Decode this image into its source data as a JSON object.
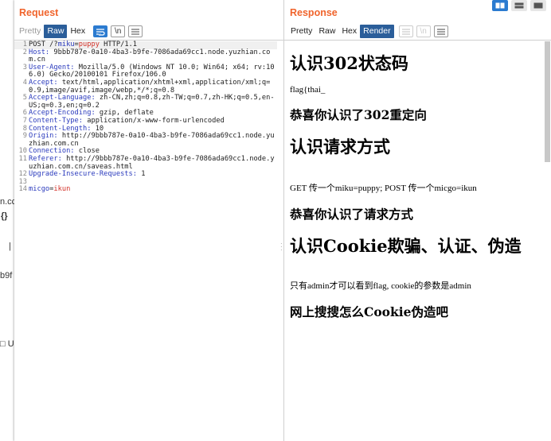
{
  "background": {
    "frag1": "n.cc",
    "frag2": "{}",
    "frag3": "|",
    "frag4": "b9f",
    "frag5": "□ U"
  },
  "layout_buttons": [
    "split-horizontal-icon",
    "split-vertical-icon",
    "single-pane-icon"
  ],
  "request": {
    "title": "Request",
    "tabs": [
      {
        "label": "Pretty",
        "state": "dim"
      },
      {
        "label": "Raw",
        "state": "active"
      },
      {
        "label": "Hex",
        "state": "normal"
      }
    ],
    "tool_icons": [
      "wrap-icon",
      "newline-icon",
      "menu-icon"
    ],
    "newline_label": "\\n",
    "lines": [
      {
        "n": "1",
        "parts": [
          {
            "t": "POST /?",
            "c": "v"
          },
          {
            "t": "miku",
            "c": "k"
          },
          {
            "t": "=",
            "c": "v"
          },
          {
            "t": "puppy",
            "c": "red"
          },
          {
            "t": " HTTP/1.1",
            "c": "v"
          }
        ]
      },
      {
        "n": "2",
        "parts": [
          {
            "t": "Host:",
            "c": "k"
          },
          {
            "t": " 9bbb787e-0a10-4ba3-b9fe-7086ada69cc1.node.yuzhian.com.cn",
            "c": "v"
          }
        ]
      },
      {
        "n": "3",
        "parts": [
          {
            "t": "User-Agent:",
            "c": "k"
          },
          {
            "t": " Mozilla/5.0 (Windows NT 10.0; Win64; x64; rv:106.0) Gecko/20100101 Firefox/106.0",
            "c": "v"
          }
        ]
      },
      {
        "n": "4",
        "parts": [
          {
            "t": "Accept:",
            "c": "k"
          },
          {
            "t": " text/html,application/xhtml+xml,application/xml;q=0.9,image/avif,image/webp,*/*;q=0.8",
            "c": "v"
          }
        ]
      },
      {
        "n": "5",
        "parts": [
          {
            "t": "Accept-Language:",
            "c": "k"
          },
          {
            "t": " zh-CN,zh;q=0.8,zh-TW;q=0.7,zh-HK;q=0.5,en-US;q=0.3,en;q=0.2",
            "c": "v"
          }
        ]
      },
      {
        "n": "6",
        "parts": [
          {
            "t": "Accept-Encoding:",
            "c": "k"
          },
          {
            "t": " gzip, deflate",
            "c": "v"
          }
        ]
      },
      {
        "n": "7",
        "parts": [
          {
            "t": "Content-Type:",
            "c": "k"
          },
          {
            "t": " application/x-www-form-urlencoded",
            "c": "v"
          }
        ]
      },
      {
        "n": "8",
        "parts": [
          {
            "t": "Content-Length:",
            "c": "k"
          },
          {
            "t": " 10",
            "c": "v"
          }
        ]
      },
      {
        "n": "9",
        "parts": [
          {
            "t": "Origin:",
            "c": "k"
          },
          {
            "t": " http://9bbb787e-0a10-4ba3-b9fe-7086ada69cc1.node.yuzhian.com.cn",
            "c": "v"
          }
        ]
      },
      {
        "n": "10",
        "parts": [
          {
            "t": "Connection:",
            "c": "k"
          },
          {
            "t": " close",
            "c": "v"
          }
        ]
      },
      {
        "n": "11",
        "parts": [
          {
            "t": "Referer:",
            "c": "k"
          },
          {
            "t": " http://9bbb787e-0a10-4ba3-b9fe-7086ada69cc1.node.yuzhian.com.cn/saveas.html",
            "c": "v"
          }
        ]
      },
      {
        "n": "12",
        "parts": [
          {
            "t": "Upgrade-Insecure-Requests:",
            "c": "k"
          },
          {
            "t": " 1",
            "c": "v"
          }
        ]
      },
      {
        "n": "13",
        "parts": [
          {
            "t": "",
            "c": "v"
          }
        ]
      },
      {
        "n": "14",
        "parts": [
          {
            "t": "micgo",
            "c": "k"
          },
          {
            "t": "=",
            "c": "v"
          },
          {
            "t": "ikun",
            "c": "red"
          }
        ]
      }
    ]
  },
  "response": {
    "title": "Response",
    "tabs": [
      {
        "label": "Pretty",
        "state": "normal"
      },
      {
        "label": "Raw",
        "state": "normal"
      },
      {
        "label": "Hex",
        "state": "normal"
      },
      {
        "label": "Render",
        "state": "active"
      }
    ],
    "tool_icons": [
      "wrap-icon",
      "newline-icon",
      "menu-icon"
    ],
    "newline_label": "\\n",
    "render": {
      "h1_1": "认识302状态码",
      "p_1": "flag{thai_",
      "h3_1": "恭喜你认识了302重定向",
      "h1_2": "认识请求方式",
      "p_2": "GET 传一个miku=puppy; POST 传一个micgo=ikun",
      "h3_2": "恭喜你认识了请求方式",
      "h1_3": "认识Cookie欺骗、认证、伪造",
      "p_3": "只有admin才可以看到flag, cookie的参数是admin",
      "h3_3": "网上搜搜怎么Cookie伪造吧"
    }
  },
  "colors": {
    "accent_title": "#f0642c",
    "active_tab": "#2b5e9a",
    "header_key": "#2b3bbd",
    "param_value": "#d4332a",
    "toggle_on": "#2b7bd0"
  }
}
